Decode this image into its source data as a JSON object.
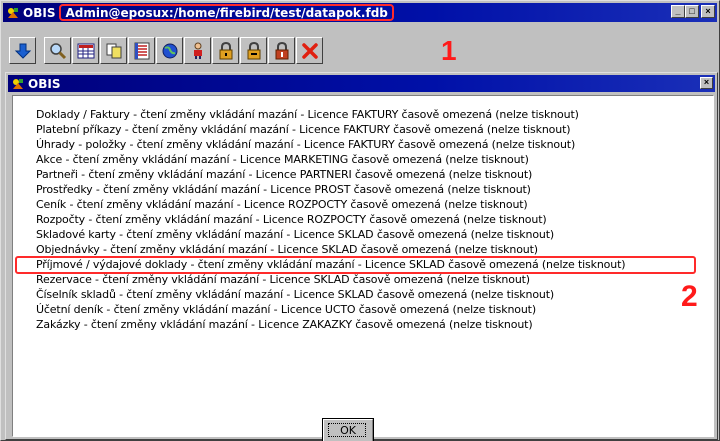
{
  "window": {
    "app_name": "OBIS",
    "path": "Admin@eposux:/home/firebird/test/datapok.fdb",
    "min_label": "_",
    "max_label": "□",
    "close_label": "×"
  },
  "toolbar": {
    "buttons": [
      {
        "icon": "down-arrow-icon"
      },
      {
        "icon": "search-icon"
      },
      {
        "icon": "grid-icon"
      },
      {
        "icon": "copy-icon"
      },
      {
        "icon": "list-icon"
      },
      {
        "icon": "globe-icon"
      },
      {
        "icon": "user-icon"
      },
      {
        "icon": "lock-1-icon"
      },
      {
        "icon": "lock-2-icon"
      },
      {
        "icon": "lock-3-icon"
      },
      {
        "icon": "delete-icon"
      }
    ]
  },
  "markers": {
    "m1": "1",
    "m2": "2"
  },
  "dialog": {
    "title": "OBIS",
    "close_label": "×",
    "lines": [
      "Doklady / Faktury - čtení změny vkládání mazání  - Licence FAKTURY časově omezená (nelze tisknout)",
      "Platební příkazy - čtení změny vkládání mazání  - Licence FAKTURY časově omezená (nelze tisknout)",
      "Úhrady - položky - čtení změny vkládání mazání  - Licence FAKTURY časově omezená (nelze tisknout)",
      "Akce - čtení změny vkládání mazání  - Licence MARKETING časově omezená (nelze tisknout)",
      "Partneři - čtení změny vkládání mazání  - Licence PARTNERI časově omezená (nelze tisknout)",
      "Prostředky - čtení změny vkládání mazání  - Licence PROST časově omezená (nelze tisknout)",
      "Ceník - čtení změny vkládání mazání  - Licence ROZPOCTY časově omezená (nelze tisknout)",
      "Rozpočty - čtení změny vkládání mazání  - Licence ROZPOCTY časově omezená (nelze tisknout)",
      "Skladové karty - čtení změny vkládání mazání  - Licence SKLAD časově omezená (nelze tisknout)",
      "Objednávky - čtení změny vkládání mazání  - Licence SKLAD časově omezená (nelze tisknout)",
      "Příjmové / výdajové doklady - čtení změny vkládání mazání  - Licence SKLAD časově omezená (nelze tisknout)",
      "Rezervace - čtení změny vkládání mazání  - Licence SKLAD časově omezená (nelze tisknout)",
      "Číselník skladů - čtení změny vkládání mazání  - Licence SKLAD časově omezená (nelze tisknout)",
      "Účetní deník - čtení změny vkládání mazání  - Licence UCTO časově omezená (nelze tisknout)",
      "Zakázky - čtení změny vkládání mazání  - Licence ZAKAZKY časově omezená (nelze tisknout)"
    ],
    "highlighted_index": 10,
    "ok_label": "OK"
  }
}
